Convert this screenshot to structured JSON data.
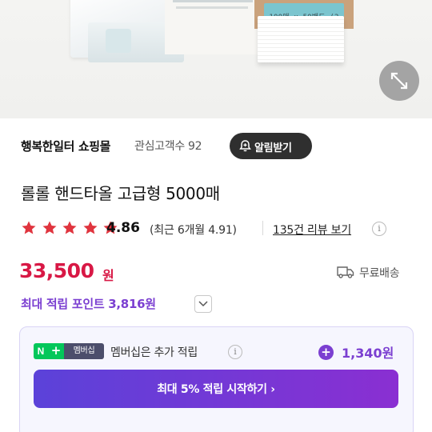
{
  "hero": {
    "box_print": "100매 x 50밴드 (2겹)"
  },
  "seller": {
    "name": "행복한일터 쇼핑몰",
    "fans": "관심고객수 92",
    "alarm_label": "알림받기"
  },
  "product": {
    "title": "롤롤 핸드타올 고급형 5000매"
  },
  "rating": {
    "stars": 5,
    "score": "4.86",
    "recent": "(최근 6개월 4.91)",
    "reviews_link": "135건 리뷰 보기",
    "info_glyph": "i"
  },
  "price": {
    "amount": "33,500",
    "unit": "원",
    "shipping": "무료배송"
  },
  "points": {
    "max_points": "최대 적립 포인트 3,816원"
  },
  "membership": {
    "badge_n": "N",
    "badge_plus": "+",
    "badge_label": "멤버십",
    "text": "멤버십은 추가 적립",
    "info_glyph": "i",
    "plus_glyph": "+",
    "bonus": "1,340원",
    "cta_label": "최대 5% 적립 시작하기 ›"
  },
  "colors": {
    "price_red": "#d81845",
    "accent_purple": "#7b3fd1",
    "star_red": "#e0343e",
    "npay_green": "#03c75a"
  },
  "icons": [
    "expand-icon",
    "bell-plus-icon",
    "star-icon",
    "info-icon",
    "truck-icon",
    "chevron-down-icon",
    "plus-circle-icon"
  ]
}
